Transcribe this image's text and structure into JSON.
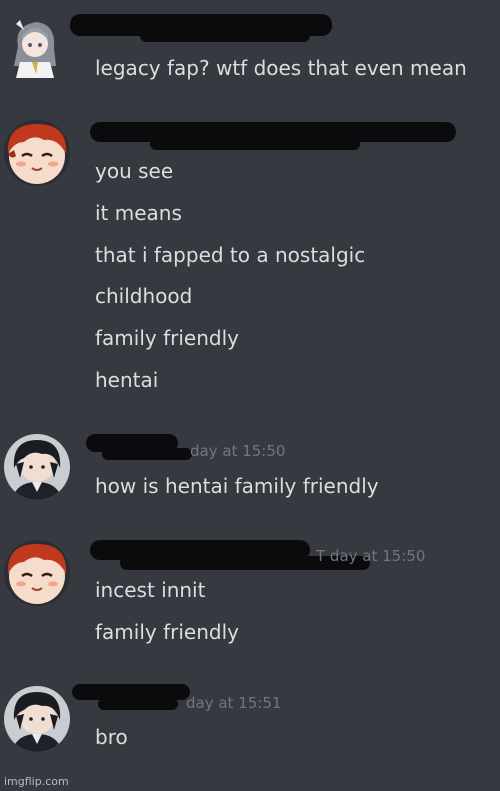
{
  "messages": [
    {
      "avatar_icon": "anime-girl-avatar-icon",
      "timestamp": "",
      "lines": [
        "legacy fap? wtf does that even mean"
      ]
    },
    {
      "avatar_icon": "redhead-boy-avatar-icon",
      "timestamp": "",
      "lines": [
        "you see",
        "it means",
        "that i fapped to a nostalgic",
        "childhood",
        "family friendly",
        "hentai"
      ]
    },
    {
      "avatar_icon": "dark-hair-boy-avatar-icon",
      "timestamp": "day at 15:50",
      "lines": [
        "how is hentai family friendly"
      ]
    },
    {
      "avatar_icon": "redhead-boy-avatar-icon",
      "timestamp": "T day at 15:50",
      "lines": [
        "incest innit",
        "family friendly"
      ]
    },
    {
      "avatar_icon": "dark-hair-boy-avatar-icon",
      "timestamp": "day at 15:51",
      "lines": [
        "bro"
      ]
    }
  ],
  "watermark": "imgflip.com",
  "colors": {
    "background": "#36393f",
    "text": "#dcddde",
    "timestamp": "#72767d",
    "redaction": "#0b0b0d"
  }
}
